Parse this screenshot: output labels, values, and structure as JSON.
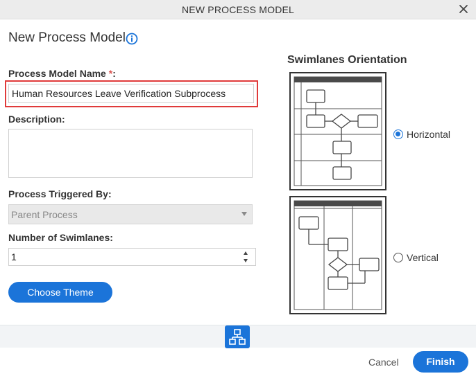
{
  "dialog": {
    "title": "NEW PROCESS MODEL",
    "heading": "New Process Model",
    "close_icon": "close-icon",
    "info_icon": "info-icon"
  },
  "form": {
    "name_label": "Process Model Name ",
    "required_mark": "*",
    "name_label_suffix": ":",
    "name_value": "Human Resources Leave Verification Subprocess",
    "description_label": "Description:",
    "description_value": "",
    "triggered_label": "Process Triggered By:",
    "triggered_value": "Parent Process",
    "swimlanes_label": "Number of Swimlanes:",
    "swimlanes_value": "1",
    "theme_button": "Choose Theme"
  },
  "orientation": {
    "title": "Swimlanes Orientation",
    "horizontal_label": "Horizontal",
    "vertical_label": "Vertical",
    "selected": "Horizontal"
  },
  "footer": {
    "cancel": "Cancel",
    "finish": "Finish",
    "tool_icon": "process-diagram-icon"
  },
  "colors": {
    "accent": "#1b74d9",
    "highlight_border": "#e03a3a"
  }
}
